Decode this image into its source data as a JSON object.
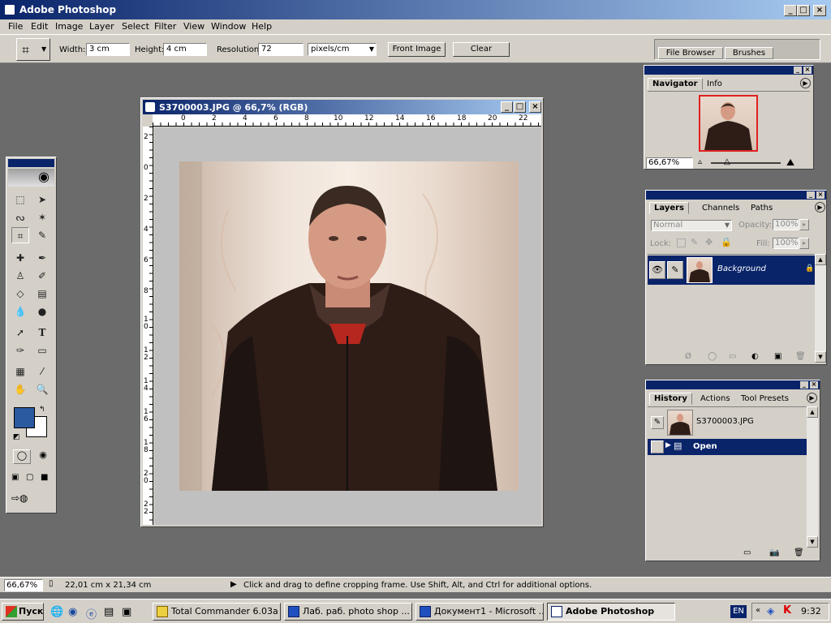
{
  "app": {
    "title": "Adobe Photoshop"
  },
  "menu": [
    "File",
    "Edit",
    "Image",
    "Layer",
    "Select",
    "Filter",
    "View",
    "Window",
    "Help"
  ],
  "options": {
    "width_label": "Width:",
    "width_value": "3 cm",
    "height_label": "Height:",
    "height_value": "4 cm",
    "resolution_label": "Resolution:",
    "resolution_value": "72",
    "unit_value": "pixels/cm",
    "front_image": "Front Image",
    "clear": "Clear"
  },
  "well": {
    "file_browser": "File Browser",
    "brushes": "Brushes"
  },
  "navigator": {
    "tab1": "Navigator",
    "tab2": "Info",
    "zoom": "66,67%"
  },
  "layers": {
    "tab1": "Layers",
    "tab2": "Channels",
    "tab3": "Paths",
    "blend_mode": "Normal",
    "opacity_label": "Opacity:",
    "opacity_value": "100%",
    "lock_label": "Lock:",
    "fill_label": "Fill:",
    "fill_value": "100%",
    "layer_name": "Background"
  },
  "history": {
    "tab1": "History",
    "tab2": "Actions",
    "tab3": "Tool Presets",
    "snapshot": "S3700003.JPG",
    "state": "Open"
  },
  "document": {
    "title": "S3700003.JPG @ 66,7% (RGB)",
    "h_ticks": [
      "0",
      "2",
      "4",
      "6",
      "8",
      "10",
      "12",
      "14",
      "16",
      "18",
      "20",
      "22"
    ],
    "v_ticks": [
      "2",
      "0",
      "2",
      "4",
      "6",
      "8",
      "1 0",
      "1 2",
      "1 4",
      "1 6",
      "1 8",
      "2 0",
      "2 2"
    ]
  },
  "status": {
    "zoom": "66,67%",
    "doc_size": "22,01 cm x 21,34 cm",
    "hint": "Click and drag to define cropping frame. Use Shift, Alt, and Ctrl for additional options."
  },
  "taskbar": {
    "start": "Пуск",
    "tasks": [
      "Total Commander 6.03a ...",
      "Лаб. раб. photo shop ...",
      "Документ1 - Microsoft ...",
      "Adobe Photoshop"
    ],
    "lang": "EN",
    "clock": "9:32"
  },
  "colors": {
    "title_blue": "#0a246a",
    "foreground": "#2c5aa0",
    "background": "#ffffff"
  }
}
